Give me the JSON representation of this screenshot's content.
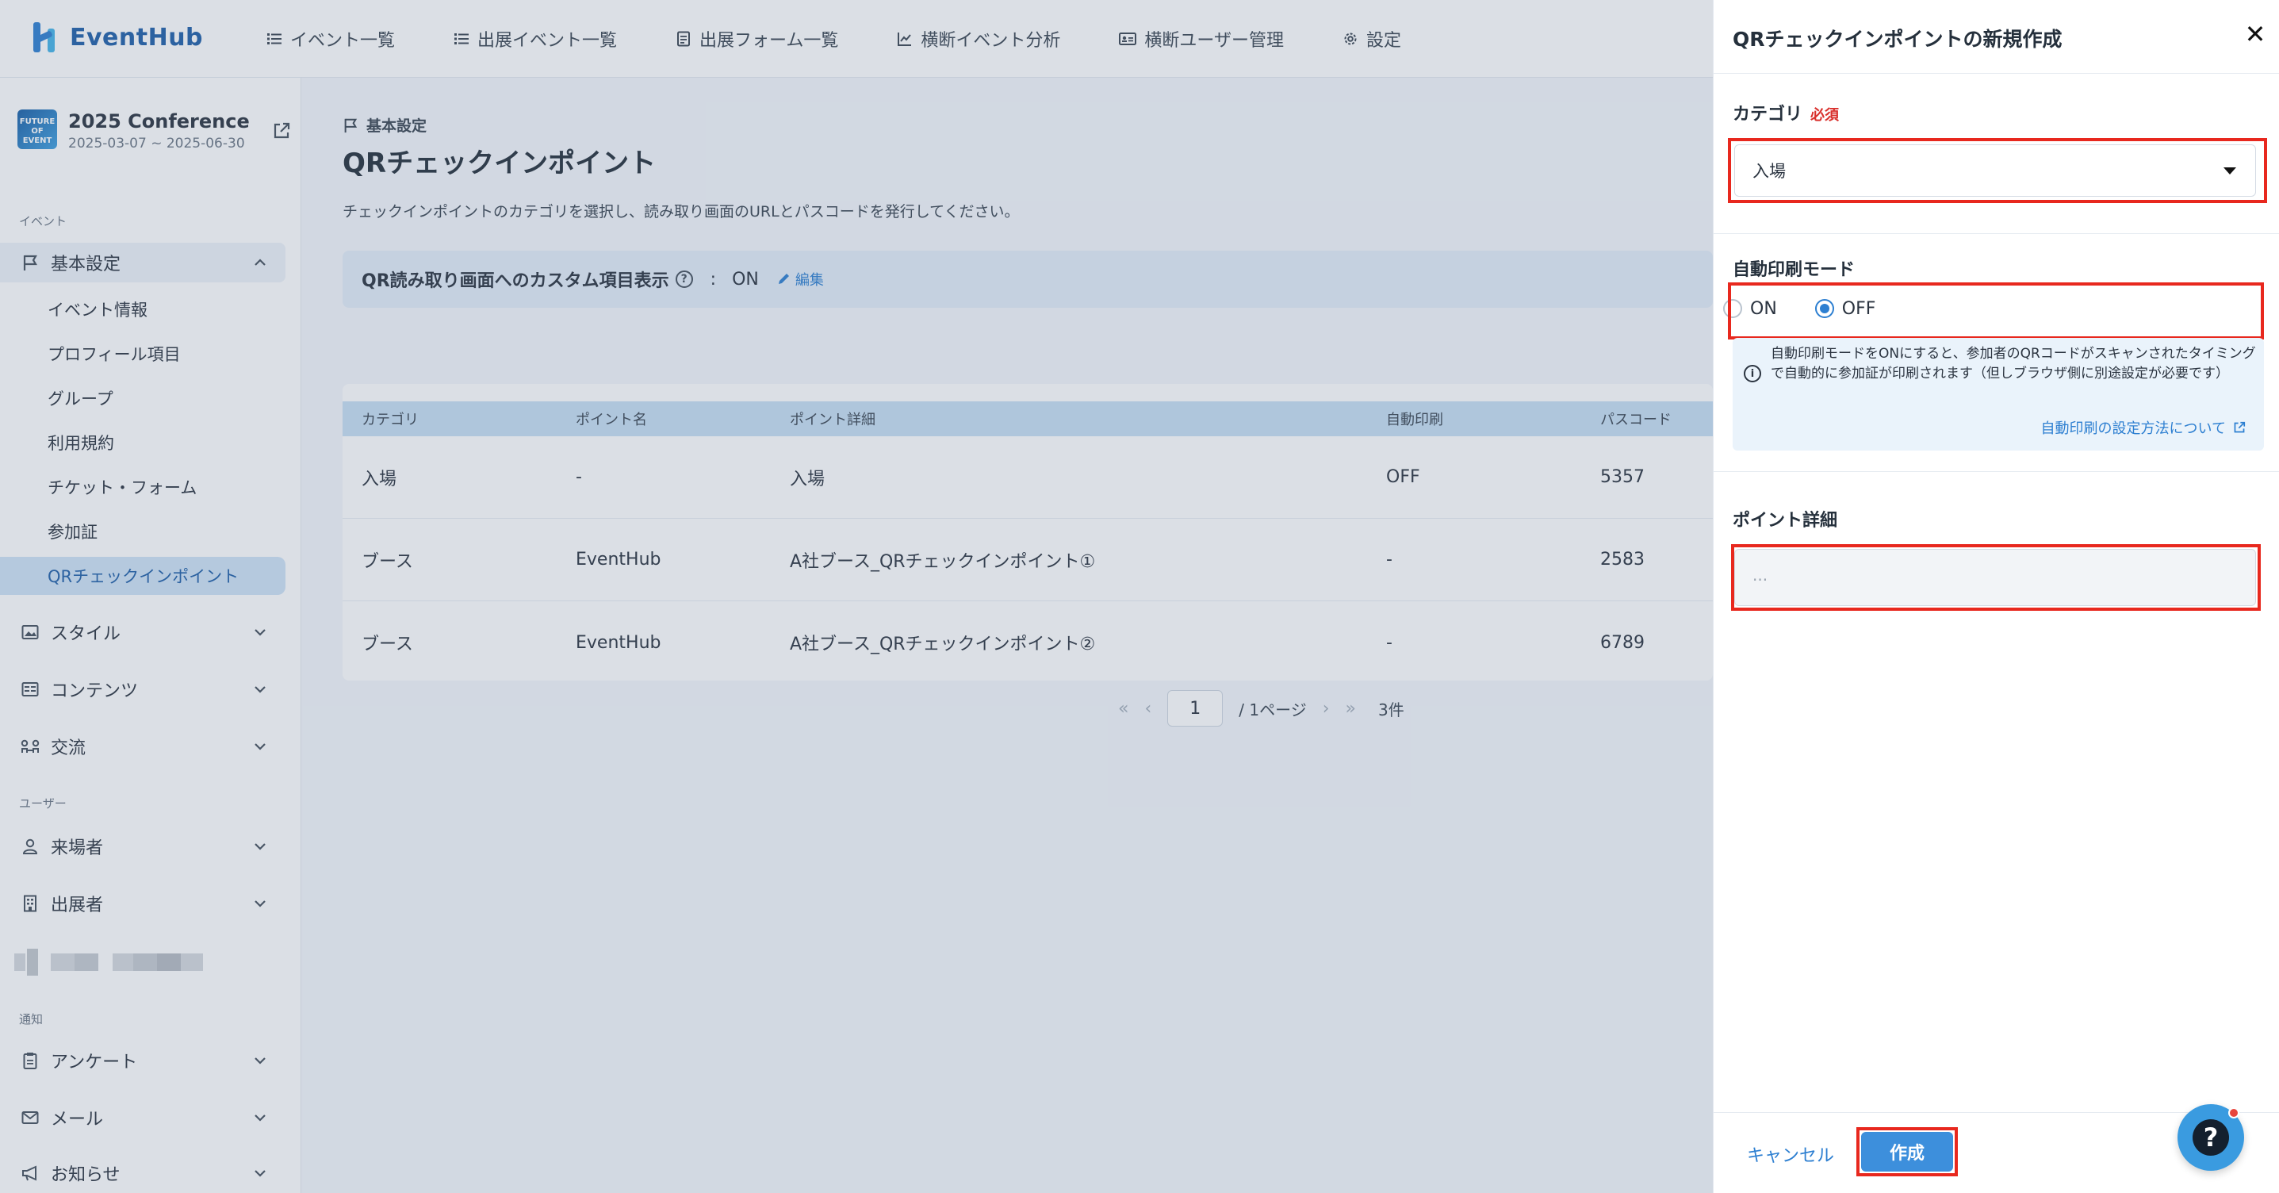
{
  "topbar": {
    "logo_text": "EventHub",
    "nav": [
      {
        "label": "イベント一覧",
        "icon": "list-icon"
      },
      {
        "label": "出展イベント一覧",
        "icon": "list-icon"
      },
      {
        "label": "出展フォーム一覧",
        "icon": "form-icon"
      },
      {
        "label": "横断イベント分析",
        "icon": "chart-icon"
      },
      {
        "label": "横断ユーザー管理",
        "icon": "user-card-icon"
      },
      {
        "label": "設定",
        "icon": "gear-icon"
      }
    ]
  },
  "sidebar": {
    "event": {
      "thumb_text": "FUTURE OF EVENT",
      "name": "2025 Conference",
      "dates": "2025-03-07 ~ 2025-06-30"
    },
    "section_event": "イベント",
    "basic_settings": "基本設定",
    "sub_items": [
      "イベント情報",
      "プロフィール項目",
      "グループ",
      "利用規約",
      "チケット・フォーム",
      "参加証",
      "QRチェックインポイント"
    ],
    "style": "スタイル",
    "contents": "コンテンツ",
    "exchange": "交流",
    "section_user": "ユーザー",
    "visitors": "来場者",
    "exhibitors": "出展者",
    "section_notify": "通知",
    "survey": "アンケート",
    "mail": "メール",
    "notice": "お知らせ"
  },
  "main": {
    "breadcrumb": "基本設定",
    "title": "QRチェックインポイント",
    "description": "チェックインポイントのカテゴリを選択し、読み取り画面のURLとパスコードを発行してください。",
    "custom_display": {
      "label": "QR読み取り画面へのカスタム項目表示",
      "colon": ":",
      "value": "ON",
      "edit": "編集"
    },
    "table": {
      "headers": [
        "カテゴリ",
        "ポイント名",
        "ポイント詳細",
        "自動印刷",
        "パスコード"
      ],
      "rows": [
        [
          "入場",
          "-",
          "入場",
          "OFF",
          "5357"
        ],
        [
          "ブース",
          "EventHub",
          "A社ブース_QRチェックインポイント①",
          "-",
          "2583"
        ],
        [
          "ブース",
          "EventHub",
          "A社ブース_QRチェックインポイント②",
          "-",
          "6789"
        ]
      ]
    },
    "pager": {
      "first": "«",
      "prev": "‹",
      "page": "1",
      "total": "/ 1ページ",
      "next": "›",
      "last": "»",
      "count": "3件"
    }
  },
  "drawer": {
    "title": "QRチェックインポイントの新規作成",
    "close": "✕",
    "category_label": "カテゴリ",
    "required": "必須",
    "category_value": "入場",
    "auto_print_label": "自動印刷モード",
    "radio_on": "ON",
    "radio_off": "OFF",
    "auto_print_selected": "OFF",
    "info_text": "自動印刷モードをONにすると、参加者のQRコードがスキャンされたタイミングで自動的に参加証が印刷されます（但しブラウザ側に別途設定が必要です）",
    "info_link": "自動印刷の設定方法について",
    "detail_label": "ポイント詳細",
    "detail_placeholder": "...",
    "cancel": "キャンセル",
    "create": "作成"
  },
  "colors": {
    "accent": "#2d7fd1",
    "highlight": "#e8281e",
    "active_bg": "#cfe3f6"
  }
}
